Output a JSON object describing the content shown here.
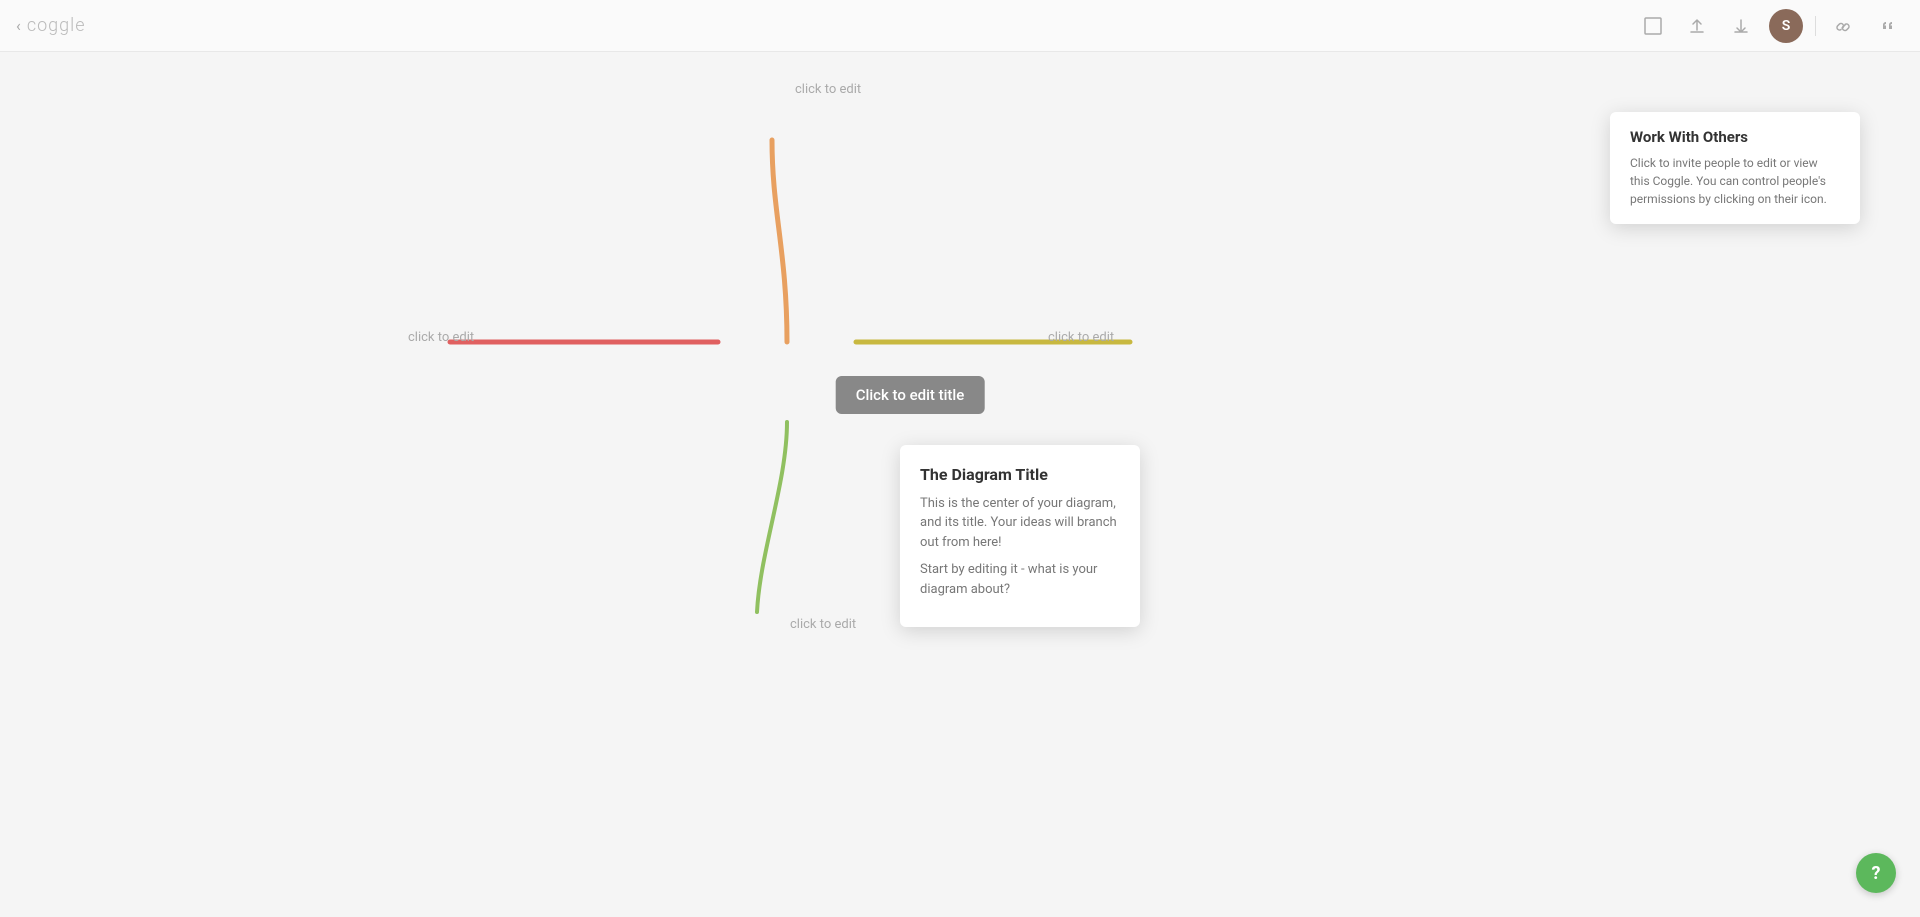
{
  "toolbar": {
    "back_icon": "‹",
    "logo": "coggle",
    "buttons": {
      "fullscreen_label": "⬜",
      "upload_label": "↑",
      "download_label": "↓",
      "link_label": "⧉",
      "quote_label": "\""
    },
    "user_initial": "S"
  },
  "collaborate_popup": {
    "title": "Work With Others",
    "description": "Click to invite people to edit or view this Coggle. You can control people's permissions by clicking on their icon."
  },
  "center_node": {
    "label": "Click to edit title"
  },
  "branches": {
    "top": {
      "label": "click to edit",
      "color": "#e8a060"
    },
    "left": {
      "label": "click to edit",
      "color": "#e06060"
    },
    "right": {
      "label": "click to edit",
      "color": "#c8b840"
    },
    "bottom": {
      "label": "click to edit",
      "color": "#90c060"
    }
  },
  "diagram_tooltip": {
    "title": "The Diagram Title",
    "para1": "This is the center of your diagram, and its title. Your ideas will branch out from here!",
    "para2": "Start by editing it - what is your diagram about?"
  },
  "help_btn_label": "?"
}
